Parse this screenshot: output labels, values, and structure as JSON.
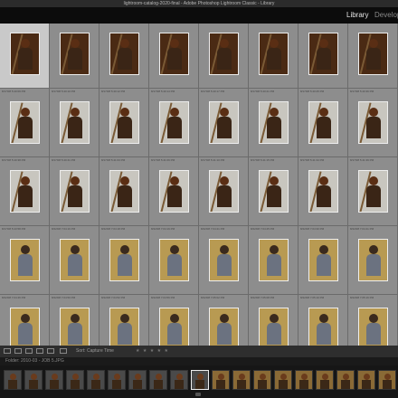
{
  "window": {
    "title": "lightroom-catalog-2020-final - Adobe Photoshop Lightroom Classic - Library"
  },
  "modules": [
    {
      "label": "Library",
      "active": true
    },
    {
      "label": "Develop",
      "active": false
    }
  ],
  "grid": {
    "rows": [
      {
        "labels": [
          "8/17/08 5:38:58 PM",
          "8/17/08 5:39:03 PM",
          "8/17/08 5:39:05 PM",
          "8/17/08 5:39:08 PM",
          "8/17/08 5:39:11 PM",
          "8/17/08 5:39:14 PM",
          "8/17/08 5:40:06 PM",
          "8/17/08 5:40:08 PM"
        ],
        "indices": [
          "180",
          "181",
          "182",
          "183",
          "184",
          "185",
          "186",
          "187"
        ],
        "tone": "warm"
      },
      {
        "labels": [
          "8/17/08 5:40:09 PM",
          "8/17/08 5:40:10 PM",
          "8/17/08 5:40:12 PM",
          "8/17/08 5:40:14 PM",
          "8/17/08 5:40:17 PM",
          "8/17/08 5:40:21 PM",
          "8/17/08 5:40:25 PM",
          "8/17/08 5:40:36 PM"
        ],
        "indices": [
          "188",
          "189",
          "190",
          "191",
          "192",
          "193",
          "194",
          "195"
        ],
        "tone": "grey"
      },
      {
        "labels": [
          "8/17/08 5:40:38 PM",
          "8/17/08 5:40:41 PM",
          "8/17/08 5:41:03 PM",
          "8/17/08 5:41:06 PM",
          "8/17/08 5:41:10 PM",
          "8/17/08 5:41:15 PM",
          "8/17/08 5:41:34 PM",
          "8/17/08 5:41:39 PM"
        ],
        "indices": [
          "196",
          "197",
          "198",
          "199",
          "200",
          "201",
          "202",
          "203"
        ],
        "tone": "grey"
      },
      {
        "labels": [
          "8/17/08 5:43:58 PM",
          "8/22/08 7:04:16 PM",
          "8/22/08 7:04:18 PM",
          "8/22/08 7:04:19 PM",
          "8/22/08 7:04:21 PM",
          "8/22/08 7:04:25 PM",
          "8/22/08 7:04:30 PM",
          "8/22/08 7:04:41 PM"
        ],
        "indices": [
          "204",
          "205",
          "206",
          "207",
          "208",
          "209",
          "210",
          "211"
        ],
        "tone": "man"
      },
      {
        "labels": [
          "8/22/08 7:04:46 PM",
          "8/22/08 7:04:50 PM",
          "8/22/08 7:04:52 PM",
          "8/22/08 7:04:56 PM",
          "8/22/08 7:05:02 PM",
          "8/22/08 7:05:08 PM",
          "8/22/08 7:05:10 PM",
          "8/22/08 7:05:16 PM"
        ],
        "indices": [
          "212",
          "213",
          "214",
          "215",
          "216",
          "217",
          "218",
          "219"
        ],
        "tone": "man"
      }
    ],
    "selected_cell": "0-0",
    "colors": {
      "warm": "#4a2a14",
      "grey": "#c8c6bf",
      "man": "#b89a52"
    }
  },
  "toolbar": {
    "sort_label": "Sort:",
    "sort_value": "Capture Time",
    "stars": "★ ★ ★ ★ ★"
  },
  "filmstrip": {
    "path": "Folder: 2010-03 - JOB 5.JPG"
  }
}
